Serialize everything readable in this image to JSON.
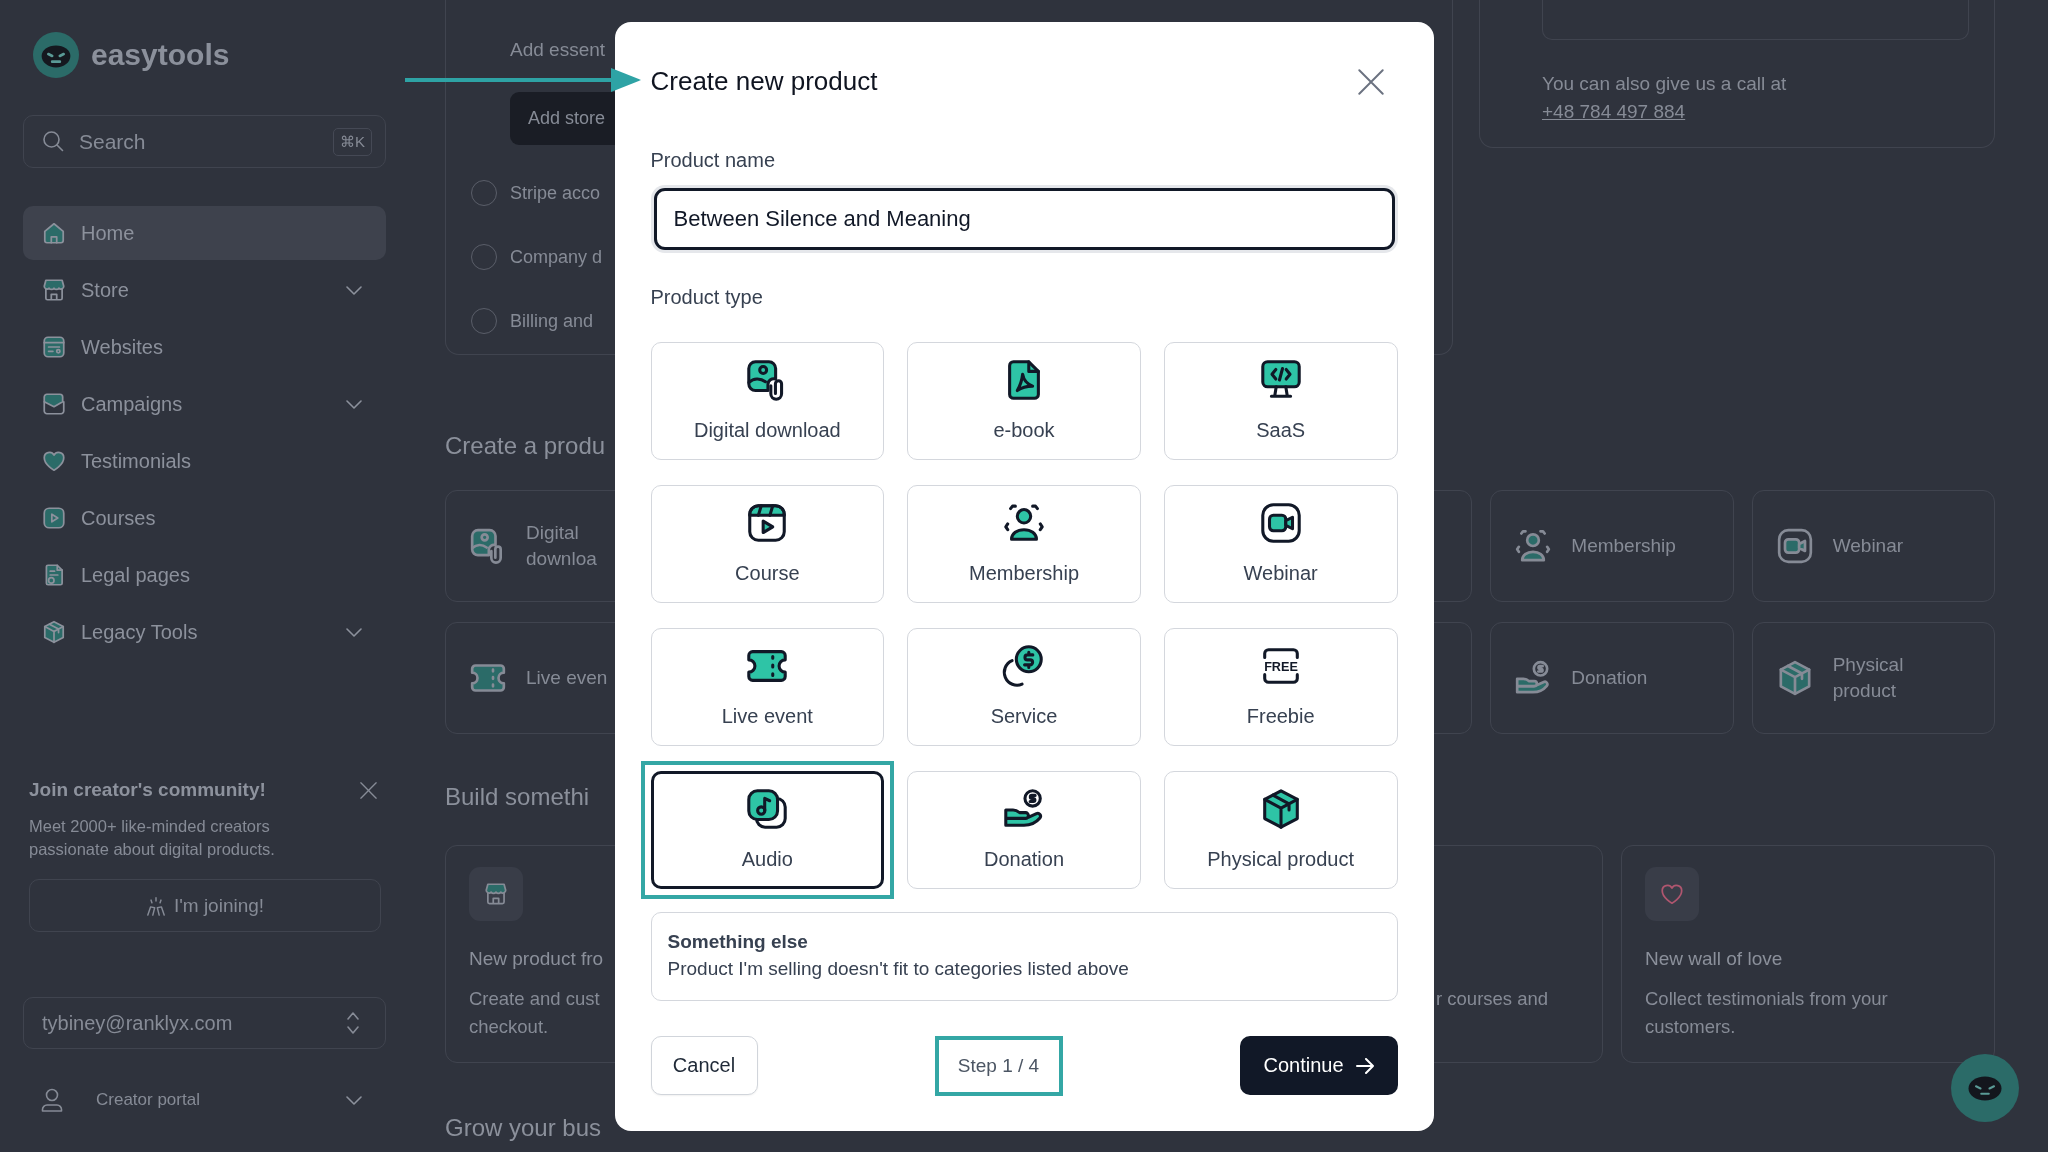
{
  "sidebar": {
    "brand": "easytools",
    "search": {
      "placeholder": "Search",
      "shortcut": "⌘K"
    },
    "nav": [
      {
        "label": "Home",
        "kind": "home",
        "selected": true,
        "has_submenu": false
      },
      {
        "label": "Store",
        "kind": "store",
        "selected": false,
        "has_submenu": true
      },
      {
        "label": "Websites",
        "kind": "websites",
        "selected": false,
        "has_submenu": false
      },
      {
        "label": "Campaigns",
        "kind": "campaigns",
        "selected": false,
        "has_submenu": true
      },
      {
        "label": "Testimonials",
        "kind": "testimonials",
        "selected": false,
        "has_submenu": false
      },
      {
        "label": "Courses",
        "kind": "courses",
        "selected": false,
        "has_submenu": false
      },
      {
        "label": "Legal pages",
        "kind": "legal",
        "selected": false,
        "has_submenu": false
      },
      {
        "label": "Legacy Tools",
        "kind": "legacy",
        "selected": false,
        "has_submenu": true
      }
    ],
    "community": {
      "title": "Join creator's community!",
      "text": "Meet 2000+ like-minded creators passionate about digital products.",
      "button": "I'm joining!"
    },
    "account": {
      "email": "tybiney@ranklyx.com"
    },
    "portal": {
      "label": "Creator portal"
    }
  },
  "dashboard": {
    "setup": {
      "text": "Add essent",
      "button": "Add store",
      "steps": [
        "Stripe acco",
        "Company d",
        "Billing and"
      ]
    },
    "contact": {
      "text": "You can also give us a call at",
      "phone": "+48 784 497 884"
    },
    "create": {
      "heading": "Create a produ",
      "rows": [
        [
          {
            "label": "Digital downloa",
            "kind": "download"
          },
          {
            "label": "Membership",
            "kind": "membership"
          },
          {
            "label": "Webinar",
            "kind": "webinar"
          }
        ],
        [
          {
            "label": "Live even",
            "kind": "event"
          },
          {
            "label": "Donation",
            "kind": "donation"
          },
          {
            "label": "Physical product",
            "kind": "physical"
          }
        ]
      ]
    },
    "build": {
      "heading": "Build somethi",
      "cards": [
        {
          "kind": "store",
          "title": "New product fro",
          "description": "Create and cust\ncheckout."
        },
        {
          "description": "r courses and"
        },
        {
          "kind": "heart",
          "title": "New wall of love",
          "description": "Collect testimonials from your customers."
        }
      ]
    },
    "grow": {
      "heading": "Grow your bus"
    }
  },
  "modal": {
    "title": "Create new product",
    "name_field": {
      "label": "Product name",
      "value": "Between Silence and Meaning",
      "focused": true
    },
    "type_label": "Product type",
    "product_types": [
      {
        "label": "Digital download",
        "kind": "download",
        "selected": false,
        "highlighted": false
      },
      {
        "label": "e-book",
        "kind": "ebook",
        "selected": false,
        "highlighted": false
      },
      {
        "label": "SaaS",
        "kind": "saas",
        "selected": false,
        "highlighted": false
      },
      {
        "label": "Course",
        "kind": "course",
        "selected": false,
        "highlighted": false
      },
      {
        "label": "Membership",
        "kind": "membership",
        "selected": false,
        "highlighted": false
      },
      {
        "label": "Webinar",
        "kind": "webinar",
        "selected": false,
        "highlighted": false
      },
      {
        "label": "Live event",
        "kind": "event",
        "selected": false,
        "highlighted": false
      },
      {
        "label": "Service",
        "kind": "service",
        "selected": false,
        "highlighted": false
      },
      {
        "label": "Freebie",
        "kind": "freebie",
        "selected": false,
        "highlighted": false
      },
      {
        "label": "Audio",
        "kind": "audio",
        "selected": true,
        "highlighted": true
      },
      {
        "label": "Donation",
        "kind": "donation",
        "selected": false,
        "highlighted": false
      },
      {
        "label": "Physical product",
        "kind": "physical",
        "selected": false,
        "highlighted": false
      }
    ],
    "freebie_icon_text": "FREE",
    "other": {
      "title": "Something else",
      "description": "Product I'm selling doesn't fit to categories listed above",
      "selected": false
    },
    "cancel": "Cancel",
    "step": {
      "text": "Step 1 / 4",
      "highlighted": true
    },
    "continue": "Continue"
  }
}
